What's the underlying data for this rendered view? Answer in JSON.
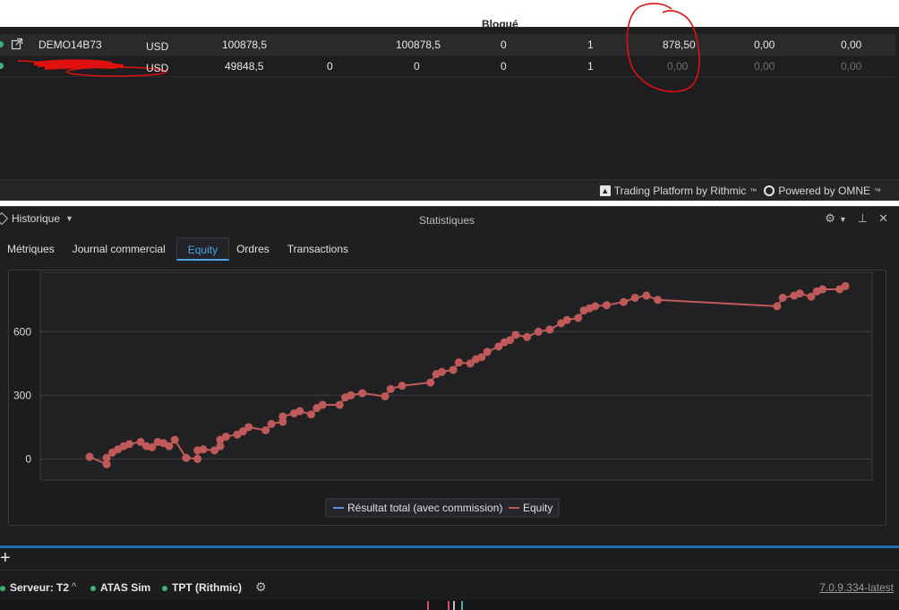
{
  "header": {
    "blocked_col": "Bloqué"
  },
  "accounts": [
    {
      "name": "DEMO14B73",
      "currency": "USD",
      "v1": "100878,5",
      "v2": "",
      "v3": "100878,5",
      "v4": "0",
      "v5": "1",
      "v6": "878,50",
      "v7": "0,00",
      "v8": "0,00"
    },
    {
      "name": "",
      "currency": "USD",
      "v1": "49848,5",
      "v2": "0",
      "v3": "0",
      "v4": "0",
      "v5": "1",
      "v6": "0,00",
      "v7": "0,00",
      "v8": "0,00"
    }
  ],
  "rithmic": {
    "left": "Trading Platform by Rithmic",
    "right": "Powered by OMNE"
  },
  "stats": {
    "history_label": "Historique",
    "title": "Statistiques",
    "tabs": [
      "Métriques",
      "Journal commercial",
      "Equity",
      "Ordres",
      "Transactions"
    ],
    "active_tab": "Equity"
  },
  "chart_data": {
    "type": "line",
    "ylim": [
      -100,
      880
    ],
    "yticks": [
      0,
      300,
      600
    ],
    "grid": true,
    "legend": "bottom-center",
    "series": [
      {
        "name": "Résultat total (avec commission)",
        "color": "#5b8fd6",
        "points": []
      },
      {
        "name": "Equity",
        "color": "#c05a5a",
        "points": [
          [
            0,
            10
          ],
          [
            3,
            -25
          ],
          [
            3,
            5
          ],
          [
            4,
            30
          ],
          [
            5,
            45
          ],
          [
            6,
            60
          ],
          [
            7,
            70
          ],
          [
            9,
            80
          ],
          [
            10,
            60
          ],
          [
            11,
            55
          ],
          [
            12,
            80
          ],
          [
            13,
            75
          ],
          [
            14,
            60
          ],
          [
            15,
            90
          ],
          [
            17,
            5
          ],
          [
            19,
            0
          ],
          [
            19,
            40
          ],
          [
            20,
            45
          ],
          [
            22,
            40
          ],
          [
            23,
            60
          ],
          [
            23,
            90
          ],
          [
            24,
            105
          ],
          [
            26,
            115
          ],
          [
            27,
            130
          ],
          [
            28,
            150
          ],
          [
            31,
            135
          ],
          [
            32,
            165
          ],
          [
            34,
            175
          ],
          [
            34,
            200
          ],
          [
            36,
            215
          ],
          [
            37,
            225
          ],
          [
            39,
            210
          ],
          [
            40,
            240
          ],
          [
            41,
            255
          ],
          [
            44,
            255
          ],
          [
            45,
            290
          ],
          [
            46,
            300
          ],
          [
            48,
            310
          ],
          [
            52,
            295
          ],
          [
            53,
            330
          ],
          [
            55,
            345
          ],
          [
            60,
            360
          ],
          [
            61,
            400
          ],
          [
            62,
            410
          ],
          [
            64,
            420
          ],
          [
            65,
            455
          ],
          [
            67,
            450
          ],
          [
            68,
            470
          ],
          [
            69,
            480
          ],
          [
            70,
            505
          ],
          [
            72,
            530
          ],
          [
            73,
            550
          ],
          [
            74,
            560
          ],
          [
            75,
            585
          ],
          [
            77,
            575
          ],
          [
            79,
            600
          ],
          [
            81,
            610
          ],
          [
            83,
            640
          ],
          [
            84,
            655
          ],
          [
            86,
            665
          ],
          [
            87,
            700
          ],
          [
            88,
            710
          ],
          [
            89,
            720
          ],
          [
            91,
            725
          ],
          [
            94,
            740
          ],
          [
            96,
            760
          ],
          [
            98,
            770
          ],
          [
            100,
            750
          ],
          [
            121,
            720
          ],
          [
            122,
            760
          ],
          [
            124,
            770
          ],
          [
            125,
            780
          ],
          [
            127,
            765
          ],
          [
            128,
            790
          ],
          [
            129,
            800
          ],
          [
            132,
            800
          ],
          [
            133,
            815
          ]
        ]
      }
    ]
  },
  "status": {
    "server": "Serveur: T2",
    "atas": "ATAS Sim",
    "tpt": "TPT (Rithmic)",
    "version": "7.0.9.334-latest"
  }
}
